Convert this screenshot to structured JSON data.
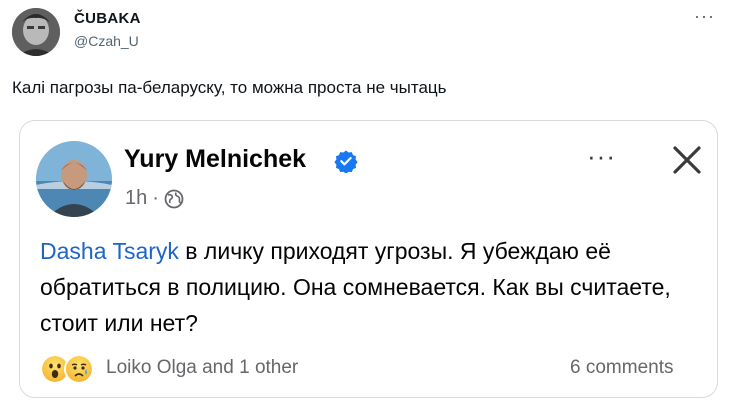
{
  "tweet": {
    "author_name": "ČUBAKA",
    "author_handle": "@Czah_U",
    "more_label": "···",
    "text": "Калі пагрозы па-беларуску, то можна проста не чытаць"
  },
  "quoted_post": {
    "author_name": "Yury Melnichek",
    "time": "1h",
    "separator": "·",
    "more_label": "···",
    "mention": "Dasha Tsaryk",
    "body": " в личку приходят угрозы. Я убеждаю её обратиться в полицию. Она сомневается. Как вы считаете, стоит или нет?",
    "reactors": "Loiko Olga and 1 other",
    "comments": "6 comments"
  },
  "icons": {
    "tweet_avatar": "avatar-photo",
    "post_avatar": "avatar-photo",
    "verified": "verified-badge-icon",
    "privacy": "globe-icon",
    "close": "close-icon",
    "reaction_1": "wow-emoji",
    "reaction_2": "sad-emoji"
  },
  "colors": {
    "mention": "#1d64c8",
    "verified": "#1877f2",
    "secondary_text": "#65676b",
    "card_border": "#d6dbe0"
  }
}
